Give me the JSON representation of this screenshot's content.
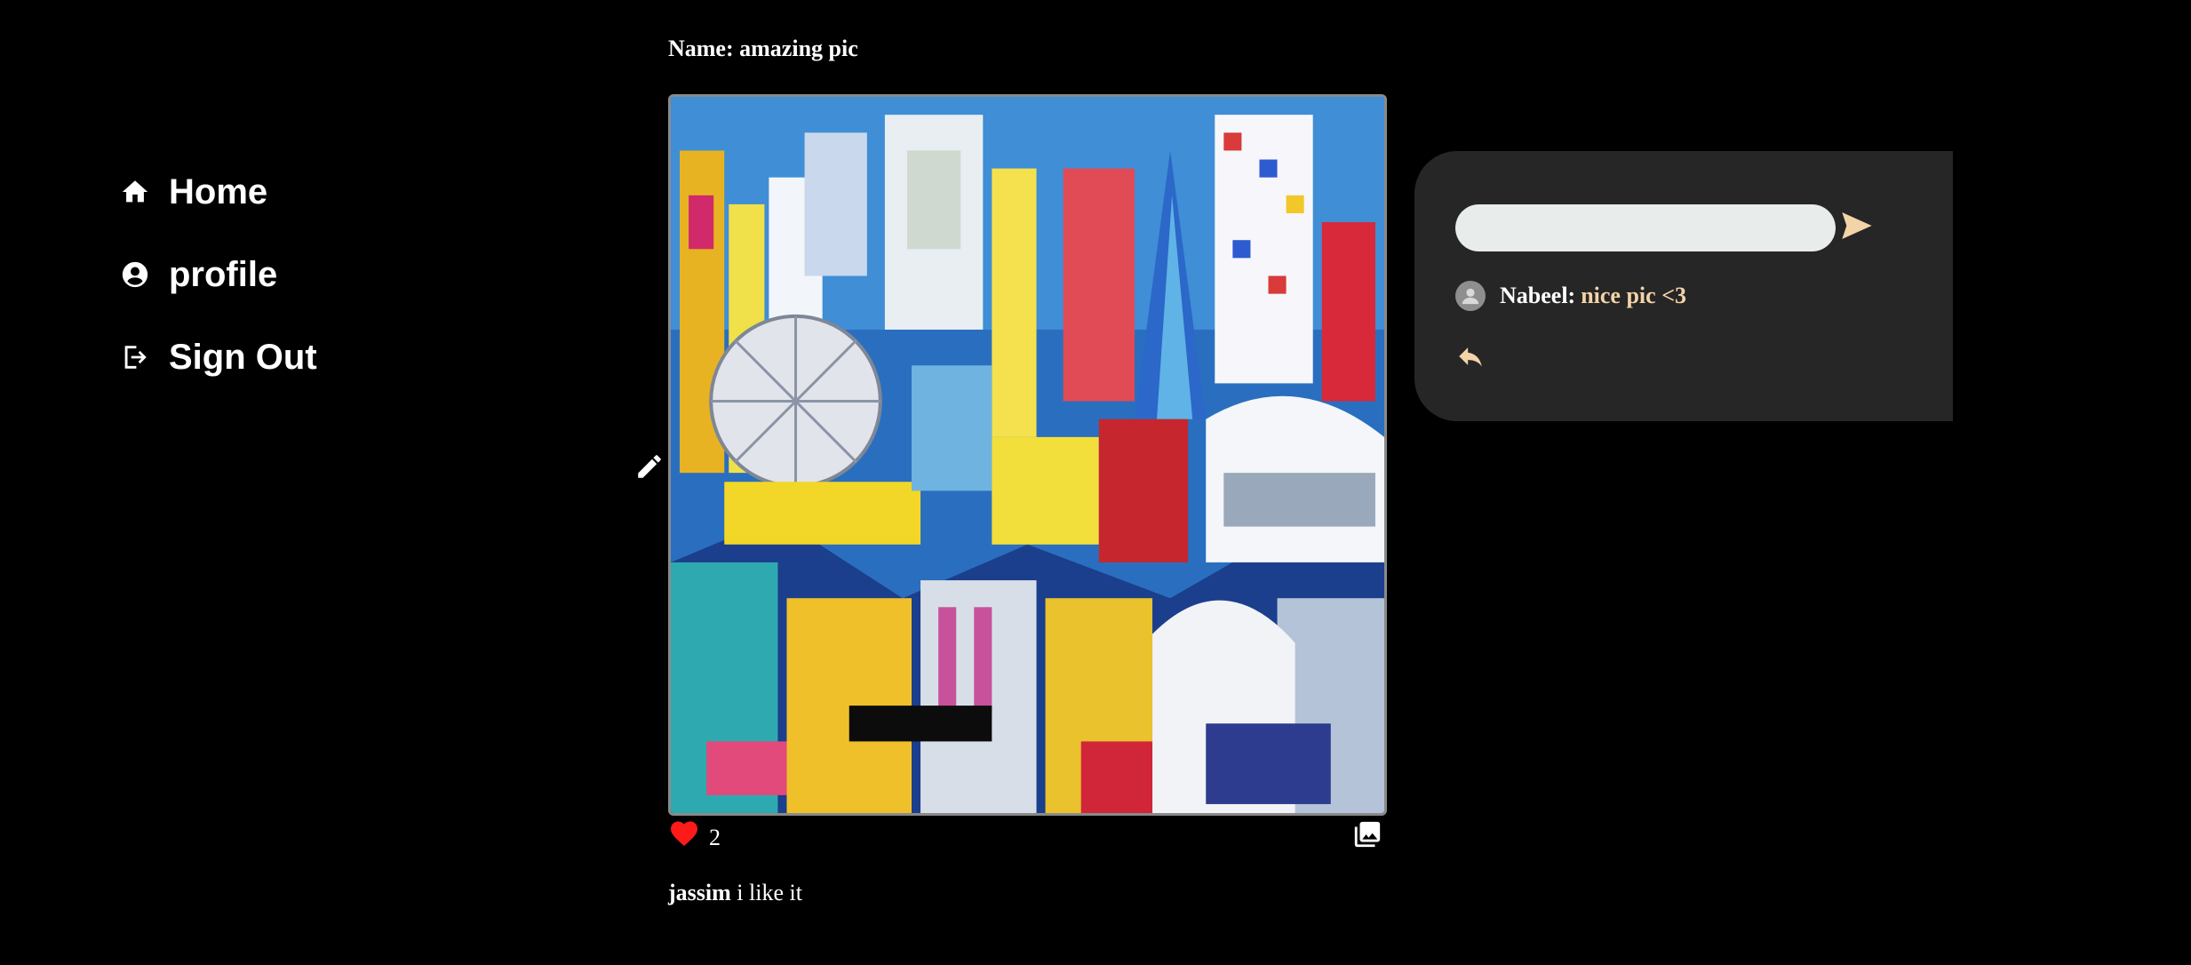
{
  "nav": {
    "items": [
      {
        "label": "Home",
        "icon": "home-icon"
      },
      {
        "label": "profile",
        "icon": "user-circle-icon"
      },
      {
        "label": "Sign Out",
        "icon": "sign-out-icon"
      }
    ]
  },
  "post": {
    "title_prefix": "Name:",
    "title": "amazing pic",
    "image_alt": "colorful abstract cityscape painting",
    "likes": "2",
    "caption_user": "jassim",
    "caption_text": "i like it"
  },
  "comments": {
    "input_value": "",
    "input_placeholder": "",
    "items": [
      {
        "user": "Nabeel:",
        "text": "nice pic <3"
      }
    ]
  },
  "colors": {
    "background": "#000000",
    "panel": "#262626",
    "accent": "#f3d3a8",
    "like": "#ff1a1a"
  }
}
